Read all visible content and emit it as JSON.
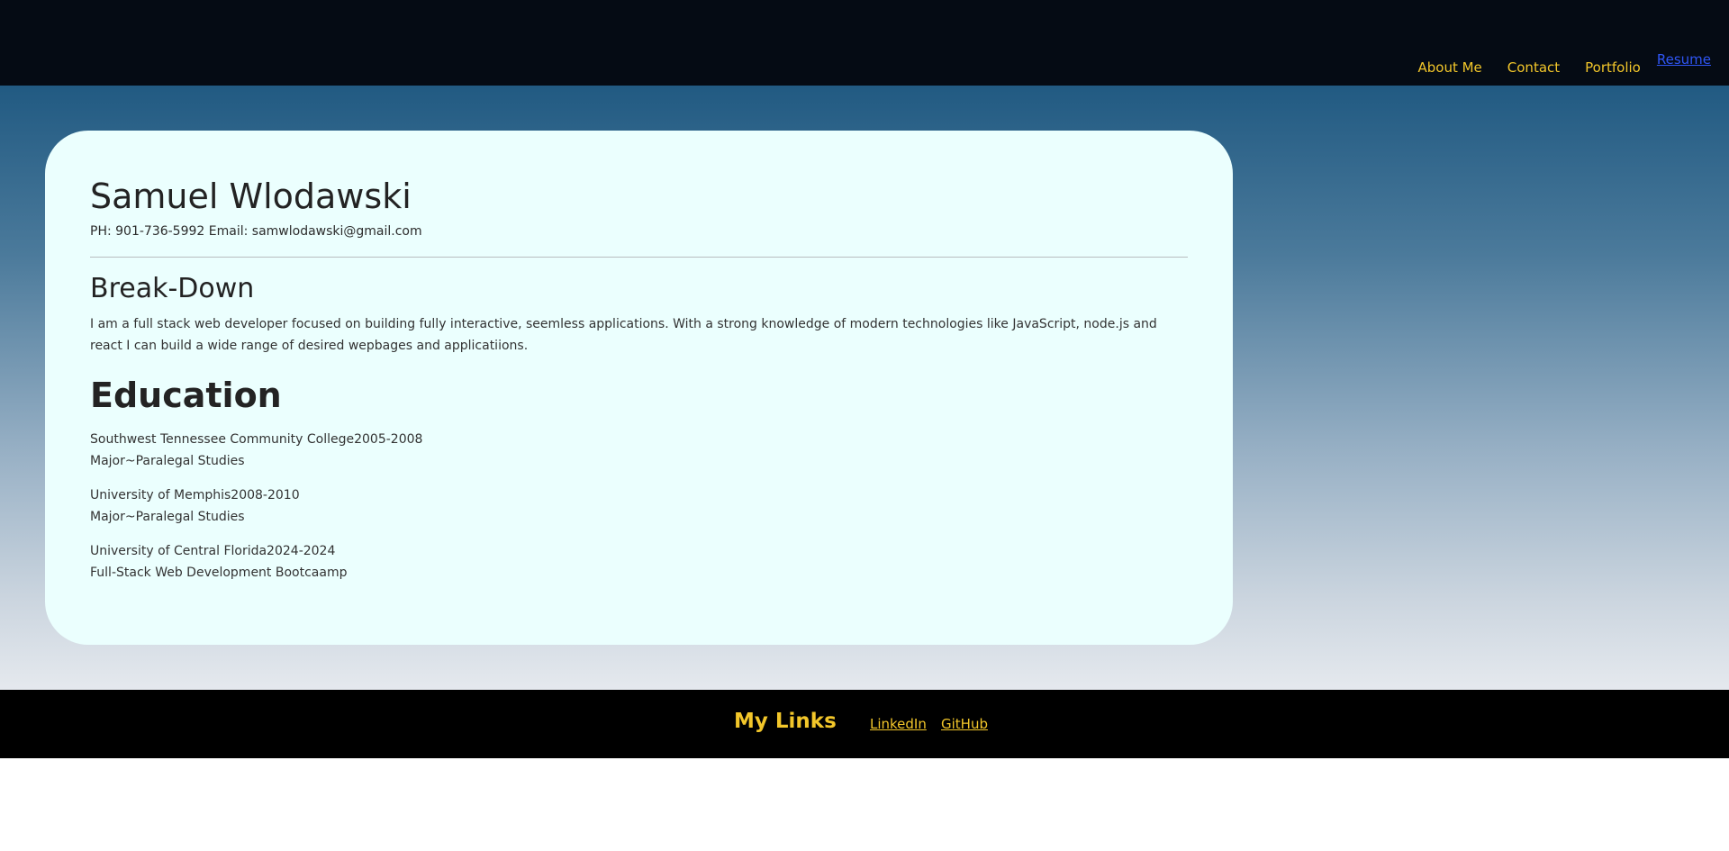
{
  "nav": {
    "items": [
      {
        "label": "About Me"
      },
      {
        "label": "Contact"
      },
      {
        "label": "Portfolio"
      }
    ],
    "resume_label": "Resume"
  },
  "profile": {
    "name": "Samuel Wlodawski",
    "contact_line": "PH: 901-736-5992 Email: samwlodawski@gmail.com"
  },
  "breakdown": {
    "title": "Break-Down",
    "text": "I am a full stack web developer focused on building fully interactive, seemless applications. With a strong knowledge of modern technologies like JavaScript, node.js and react I can build a wide range of desired wepbages and applicatiions."
  },
  "education": {
    "title": "Education",
    "entries": [
      {
        "school_years": "Southwest Tennessee Community College2005-2008",
        "major": "Major~Paralegal Studies"
      },
      {
        "school_years": "University of Memphis2008-2010",
        "major": "Major~Paralegal Studies"
      },
      {
        "school_years": "University of Central Florida2024-2024",
        "major": "Full-Stack Web Development Bootcaamp"
      }
    ]
  },
  "footer": {
    "title": "My Links",
    "links": [
      {
        "label": "LinkedIn"
      },
      {
        "label": "GitHub"
      }
    ]
  },
  "colors": {
    "accent": "#f2c62a",
    "header_bg": "#050b14",
    "card_bg": "#ebfffe",
    "footer_bg": "#000000",
    "resume_link": "#2f56f5"
  }
}
